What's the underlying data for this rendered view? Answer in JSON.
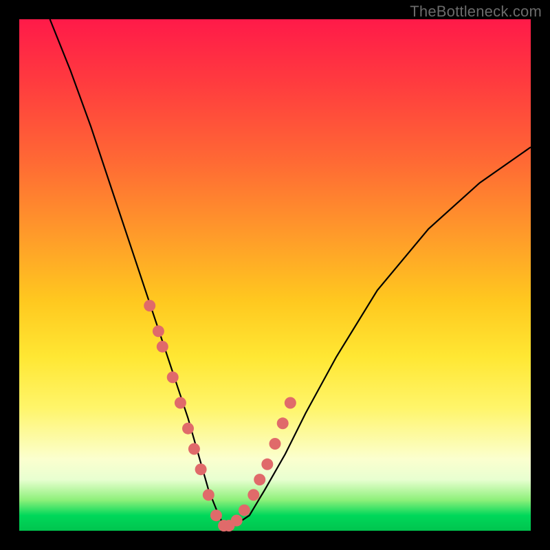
{
  "watermark": "TheBottleneck.com",
  "chart_data": {
    "type": "line",
    "title": "",
    "xlabel": "",
    "ylabel": "",
    "xlim": [
      0,
      100
    ],
    "ylim": [
      0,
      100
    ],
    "curve": {
      "name": "bottleneck-curve",
      "x": [
        6,
        10,
        14,
        18,
        22,
        25,
        27,
        29,
        31,
        33,
        35,
        37,
        39,
        40,
        42,
        45,
        48,
        52,
        56,
        62,
        70,
        80,
        90,
        100
      ],
      "y": [
        100,
        90,
        79,
        67,
        55,
        46,
        40,
        34,
        28,
        22,
        15,
        8,
        3,
        1,
        1,
        3,
        8,
        15,
        23,
        34,
        47,
        59,
        68,
        75
      ]
    },
    "markers": {
      "name": "highlighted-range",
      "x": [
        25.5,
        27.2,
        28.0,
        30.0,
        31.5,
        33.0,
        34.2,
        35.5,
        37.0,
        38.5,
        40.0,
        41.0,
        42.5,
        44.0,
        45.8,
        47.0,
        48.5,
        50.0,
        51.5,
        53.0
      ],
      "y": [
        44,
        39,
        36,
        30,
        25,
        20,
        16,
        12,
        7,
        3,
        1,
        1,
        2,
        4,
        7,
        10,
        13,
        17,
        21,
        25
      ]
    },
    "background_gradient": {
      "top": "#ff1a49",
      "quarter": "#ff9a2a",
      "mid": "#ffe733",
      "lower": "#fbffcf",
      "bottom": "#00c44e"
    }
  }
}
